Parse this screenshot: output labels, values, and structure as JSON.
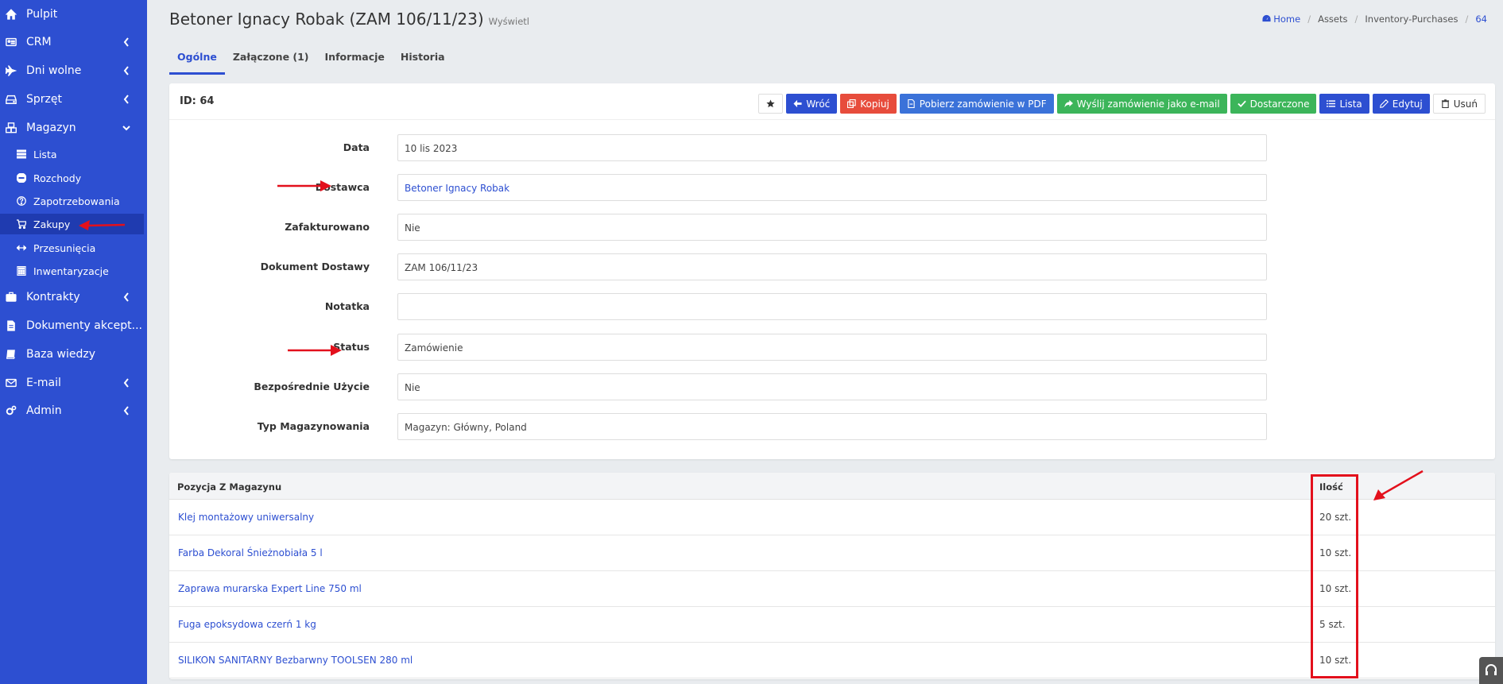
{
  "sidebar": {
    "items": [
      {
        "label": "Pulpit",
        "icon": "home-icon"
      },
      {
        "label": "CRM",
        "icon": "id-card-icon"
      },
      {
        "label": "Dni wolne",
        "icon": "plane-icon"
      },
      {
        "label": "Sprzęt",
        "icon": "hdd-icon"
      },
      {
        "label": "Magazyn",
        "icon": "cubes-icon"
      },
      {
        "label": "Kontrakty",
        "icon": "briefcase-icon"
      },
      {
        "label": "Dokumenty akcept...",
        "icon": "file-icon"
      },
      {
        "label": "Baza wiedzy",
        "icon": "book-icon"
      },
      {
        "label": "E-mail",
        "icon": "envelope-icon"
      },
      {
        "label": "Admin",
        "icon": "cogs-icon"
      }
    ],
    "magazyn_sub": [
      {
        "label": "Lista",
        "icon": "list-icon"
      },
      {
        "label": "Rozchody",
        "icon": "minus-circle-icon"
      },
      {
        "label": "Zapotrzebowania",
        "icon": "question-circle-icon"
      },
      {
        "label": "Zakupy",
        "icon": "cart-icon"
      },
      {
        "label": "Przesunięcia",
        "icon": "arrows-h-icon"
      },
      {
        "label": "Inwentaryzacje",
        "icon": "calculator-icon"
      }
    ]
  },
  "header": {
    "title": "Betoner Ignacy Robak (ZAM 106/11/23)",
    "subtitle": "Wyświetl",
    "breadcrumb": [
      "Home",
      "Assets",
      "Inventory-Purchases",
      "64"
    ]
  },
  "tabs": [
    "Ogólne",
    "Załączone (1)",
    "Informacje",
    "Historia"
  ],
  "card": {
    "id_label": "ID: 64",
    "buttons": {
      "back": "Wróć",
      "copy": "Kopiuj",
      "pdf": "Pobierz zamówienie w PDF",
      "email": "Wyślij zamówienie jako e-mail",
      "delivered": "Dostarczone",
      "list": "Lista",
      "edit": "Edytuj",
      "delete": "Usuń"
    },
    "fields": [
      {
        "label": "Data",
        "value": "10 lis 2023"
      },
      {
        "label": "Dostawca",
        "value": "Betoner Ignacy Robak"
      },
      {
        "label": "Zafakturowano",
        "value": "Nie"
      },
      {
        "label": "Dokument Dostawy",
        "value": "ZAM 106/11/23"
      },
      {
        "label": "Notatka",
        "value": ""
      },
      {
        "label": "Status",
        "value": "Zamówienie"
      },
      {
        "label": "Bezpośrednie Użycie",
        "value": "Nie"
      },
      {
        "label": "Typ Magazynowania",
        "value": "Magazyn: Główny, Poland"
      }
    ]
  },
  "table": {
    "headers": [
      "Pozycja Z Magazynu",
      "Ilość"
    ],
    "rows": [
      {
        "item": "Klej montażowy uniwersalny",
        "qty": "20 szt."
      },
      {
        "item": "Farba Dekoral Śnieżnobiała 5 l",
        "qty": "10 szt."
      },
      {
        "item": "Zaprawa murarska Expert Line 750 ml",
        "qty": "10 szt."
      },
      {
        "item": "Fuga epoksydowa czerń 1 kg",
        "qty": "5 szt."
      },
      {
        "item": "SILIKON SANITARNY Bezbarwny TOOLSEN 280 ml",
        "qty": "10 szt."
      }
    ]
  },
  "colors": {
    "sidebar": "#2d4fd1",
    "primary": "#2d4fd1",
    "danger": "#e74c3c",
    "success": "#3cb55a",
    "annotation": "#e3101c"
  }
}
